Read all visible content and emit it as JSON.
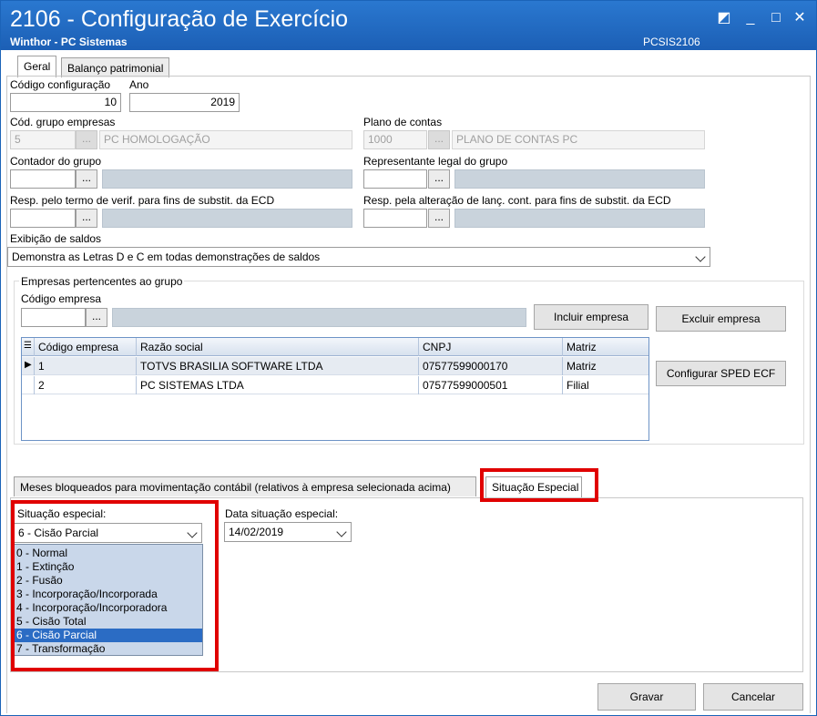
{
  "window": {
    "title": "2106 - Configuração de Exercício",
    "subtitle": "Winthor - PC Sistemas",
    "code": "PCSIS2106",
    "restore_glyph": "◩",
    "minimize_glyph": "_",
    "maximize_glyph": "□",
    "close_glyph": "✕"
  },
  "tabs": {
    "geral": "Geral",
    "balanco": "Balanço patrimonial"
  },
  "fields": {
    "codigo_config_label": "Código configuração",
    "codigo_config_value": "10",
    "ano_label": "Ano",
    "ano_value": "2019",
    "grupo_label": "Cód. grupo empresas",
    "grupo_code": "5",
    "grupo_name": "PC HOMOLOGAÇÃO",
    "plano_label": "Plano de contas",
    "plano_code": "1000",
    "plano_name": "PLANO DE CONTAS PC",
    "contador_label": "Contador do grupo",
    "representante_label": "Representante legal do grupo",
    "resp_termo_label": "Resp. pelo termo de verif. para fins de substit. da ECD",
    "resp_alteracao_label": "Resp. pela alteração de lanç. cont. para fins de substit. da ECD",
    "exibicao_label": "Exibição de saldos",
    "exibicao_value": "Demonstra as Letras D e C em todas demonstrações de saldos",
    "dots": "..."
  },
  "empresas": {
    "group_title": "Empresas pertencentes ao grupo",
    "codigo_label": "Código empresa",
    "incluir": "Incluir empresa",
    "excluir": "Excluir empresa",
    "configurar": "Configurar SPED ECF",
    "columns": [
      "Código empresa",
      "Razão social",
      "CNPJ",
      "Matriz"
    ],
    "rows": [
      {
        "codigo": "1",
        "razao": "TOTVS BRASILIA SOFTWARE LTDA",
        "cnpj": "07577599000170",
        "matriz": "Matriz"
      },
      {
        "codigo": "2",
        "razao": "PC SISTEMAS LTDA",
        "cnpj": "07577599000501",
        "matriz": "Filial"
      }
    ]
  },
  "lower_tabs": {
    "meses": "Meses bloqueados para movimentação contábil (relativos à empresa selecionada acima)",
    "situacao": "Situação Especial"
  },
  "situacao": {
    "label": "Situação especial:",
    "selected": "6 - Cisão Parcial",
    "options": [
      "0 - Normal",
      "1 - Extinção",
      "2 - Fusão",
      "3 - Incorporação/Incorporada",
      "4 - Incorporação/Incorporadora",
      "5 - Cisão Total",
      "6 - Cisão Parcial",
      "7 - Transformação"
    ],
    "selected_index": 6,
    "data_label": "Data situação especial:",
    "data_value": "14/02/2019"
  },
  "actions": {
    "gravar": "Gravar",
    "cancelar": "Cancelar"
  },
  "colors": {
    "title_bar": "#1c5fb5",
    "highlight": "#e00000",
    "selection": "#2b6cc4"
  }
}
